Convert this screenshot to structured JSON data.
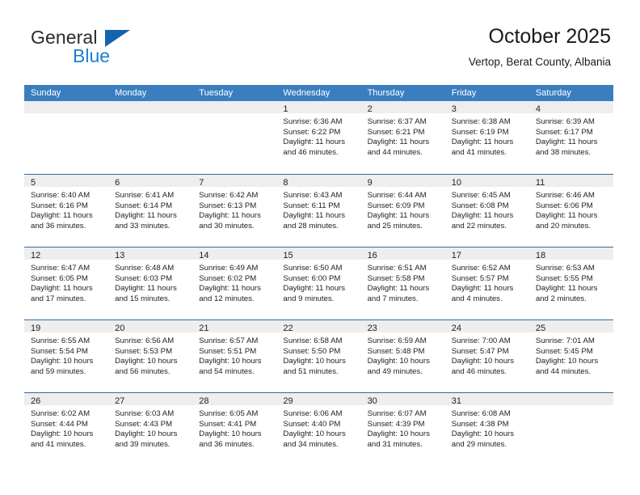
{
  "brand": {
    "word1": "General",
    "word2": "Blue",
    "accent_color": "#1265ad",
    "blue_text_color": "#1a7fd4"
  },
  "header": {
    "title": "October 2025",
    "subtitle": "Vertop, Berat County, Albania"
  },
  "theme": {
    "header_row_bg": "#3b7ec0",
    "week_divider": "#2e6da4",
    "dateband_bg": "#eeeeee"
  },
  "weekdays": [
    "Sunday",
    "Monday",
    "Tuesday",
    "Wednesday",
    "Thursday",
    "Friday",
    "Saturday"
  ],
  "labels": {
    "sunrise": "Sunrise:",
    "sunset": "Sunset:",
    "daylight": "Daylight:"
  },
  "weeks": [
    [
      {
        "day": "",
        "empty": true
      },
      {
        "day": "",
        "empty": true
      },
      {
        "day": "",
        "empty": true
      },
      {
        "day": "1",
        "sunrise": "Sunrise: 6:36 AM",
        "sunset": "Sunset: 6:22 PM",
        "daylight": "Daylight: 11 hours and 46 minutes."
      },
      {
        "day": "2",
        "sunrise": "Sunrise: 6:37 AM",
        "sunset": "Sunset: 6:21 PM",
        "daylight": "Daylight: 11 hours and 44 minutes."
      },
      {
        "day": "3",
        "sunrise": "Sunrise: 6:38 AM",
        "sunset": "Sunset: 6:19 PM",
        "daylight": "Daylight: 11 hours and 41 minutes."
      },
      {
        "day": "4",
        "sunrise": "Sunrise: 6:39 AM",
        "sunset": "Sunset: 6:17 PM",
        "daylight": "Daylight: 11 hours and 38 minutes."
      }
    ],
    [
      {
        "day": "5",
        "sunrise": "Sunrise: 6:40 AM",
        "sunset": "Sunset: 6:16 PM",
        "daylight": "Daylight: 11 hours and 36 minutes."
      },
      {
        "day": "6",
        "sunrise": "Sunrise: 6:41 AM",
        "sunset": "Sunset: 6:14 PM",
        "daylight": "Daylight: 11 hours and 33 minutes."
      },
      {
        "day": "7",
        "sunrise": "Sunrise: 6:42 AM",
        "sunset": "Sunset: 6:13 PM",
        "daylight": "Daylight: 11 hours and 30 minutes."
      },
      {
        "day": "8",
        "sunrise": "Sunrise: 6:43 AM",
        "sunset": "Sunset: 6:11 PM",
        "daylight": "Daylight: 11 hours and 28 minutes."
      },
      {
        "day": "9",
        "sunrise": "Sunrise: 6:44 AM",
        "sunset": "Sunset: 6:09 PM",
        "daylight": "Daylight: 11 hours and 25 minutes."
      },
      {
        "day": "10",
        "sunrise": "Sunrise: 6:45 AM",
        "sunset": "Sunset: 6:08 PM",
        "daylight": "Daylight: 11 hours and 22 minutes."
      },
      {
        "day": "11",
        "sunrise": "Sunrise: 6:46 AM",
        "sunset": "Sunset: 6:06 PM",
        "daylight": "Daylight: 11 hours and 20 minutes."
      }
    ],
    [
      {
        "day": "12",
        "sunrise": "Sunrise: 6:47 AM",
        "sunset": "Sunset: 6:05 PM",
        "daylight": "Daylight: 11 hours and 17 minutes."
      },
      {
        "day": "13",
        "sunrise": "Sunrise: 6:48 AM",
        "sunset": "Sunset: 6:03 PM",
        "daylight": "Daylight: 11 hours and 15 minutes."
      },
      {
        "day": "14",
        "sunrise": "Sunrise: 6:49 AM",
        "sunset": "Sunset: 6:02 PM",
        "daylight": "Daylight: 11 hours and 12 minutes."
      },
      {
        "day": "15",
        "sunrise": "Sunrise: 6:50 AM",
        "sunset": "Sunset: 6:00 PM",
        "daylight": "Daylight: 11 hours and 9 minutes."
      },
      {
        "day": "16",
        "sunrise": "Sunrise: 6:51 AM",
        "sunset": "Sunset: 5:58 PM",
        "daylight": "Daylight: 11 hours and 7 minutes."
      },
      {
        "day": "17",
        "sunrise": "Sunrise: 6:52 AM",
        "sunset": "Sunset: 5:57 PM",
        "daylight": "Daylight: 11 hours and 4 minutes."
      },
      {
        "day": "18",
        "sunrise": "Sunrise: 6:53 AM",
        "sunset": "Sunset: 5:55 PM",
        "daylight": "Daylight: 11 hours and 2 minutes."
      }
    ],
    [
      {
        "day": "19",
        "sunrise": "Sunrise: 6:55 AM",
        "sunset": "Sunset: 5:54 PM",
        "daylight": "Daylight: 10 hours and 59 minutes."
      },
      {
        "day": "20",
        "sunrise": "Sunrise: 6:56 AM",
        "sunset": "Sunset: 5:53 PM",
        "daylight": "Daylight: 10 hours and 56 minutes."
      },
      {
        "day": "21",
        "sunrise": "Sunrise: 6:57 AM",
        "sunset": "Sunset: 5:51 PM",
        "daylight": "Daylight: 10 hours and 54 minutes."
      },
      {
        "day": "22",
        "sunrise": "Sunrise: 6:58 AM",
        "sunset": "Sunset: 5:50 PM",
        "daylight": "Daylight: 10 hours and 51 minutes."
      },
      {
        "day": "23",
        "sunrise": "Sunrise: 6:59 AM",
        "sunset": "Sunset: 5:48 PM",
        "daylight": "Daylight: 10 hours and 49 minutes."
      },
      {
        "day": "24",
        "sunrise": "Sunrise: 7:00 AM",
        "sunset": "Sunset: 5:47 PM",
        "daylight": "Daylight: 10 hours and 46 minutes."
      },
      {
        "day": "25",
        "sunrise": "Sunrise: 7:01 AM",
        "sunset": "Sunset: 5:45 PM",
        "daylight": "Daylight: 10 hours and 44 minutes."
      }
    ],
    [
      {
        "day": "26",
        "sunrise": "Sunrise: 6:02 AM",
        "sunset": "Sunset: 4:44 PM",
        "daylight": "Daylight: 10 hours and 41 minutes."
      },
      {
        "day": "27",
        "sunrise": "Sunrise: 6:03 AM",
        "sunset": "Sunset: 4:43 PM",
        "daylight": "Daylight: 10 hours and 39 minutes."
      },
      {
        "day": "28",
        "sunrise": "Sunrise: 6:05 AM",
        "sunset": "Sunset: 4:41 PM",
        "daylight": "Daylight: 10 hours and 36 minutes."
      },
      {
        "day": "29",
        "sunrise": "Sunrise: 6:06 AM",
        "sunset": "Sunset: 4:40 PM",
        "daylight": "Daylight: 10 hours and 34 minutes."
      },
      {
        "day": "30",
        "sunrise": "Sunrise: 6:07 AM",
        "sunset": "Sunset: 4:39 PM",
        "daylight": "Daylight: 10 hours and 31 minutes."
      },
      {
        "day": "31",
        "sunrise": "Sunrise: 6:08 AM",
        "sunset": "Sunset: 4:38 PM",
        "daylight": "Daylight: 10 hours and 29 minutes."
      },
      {
        "day": "",
        "empty": true
      }
    ]
  ]
}
